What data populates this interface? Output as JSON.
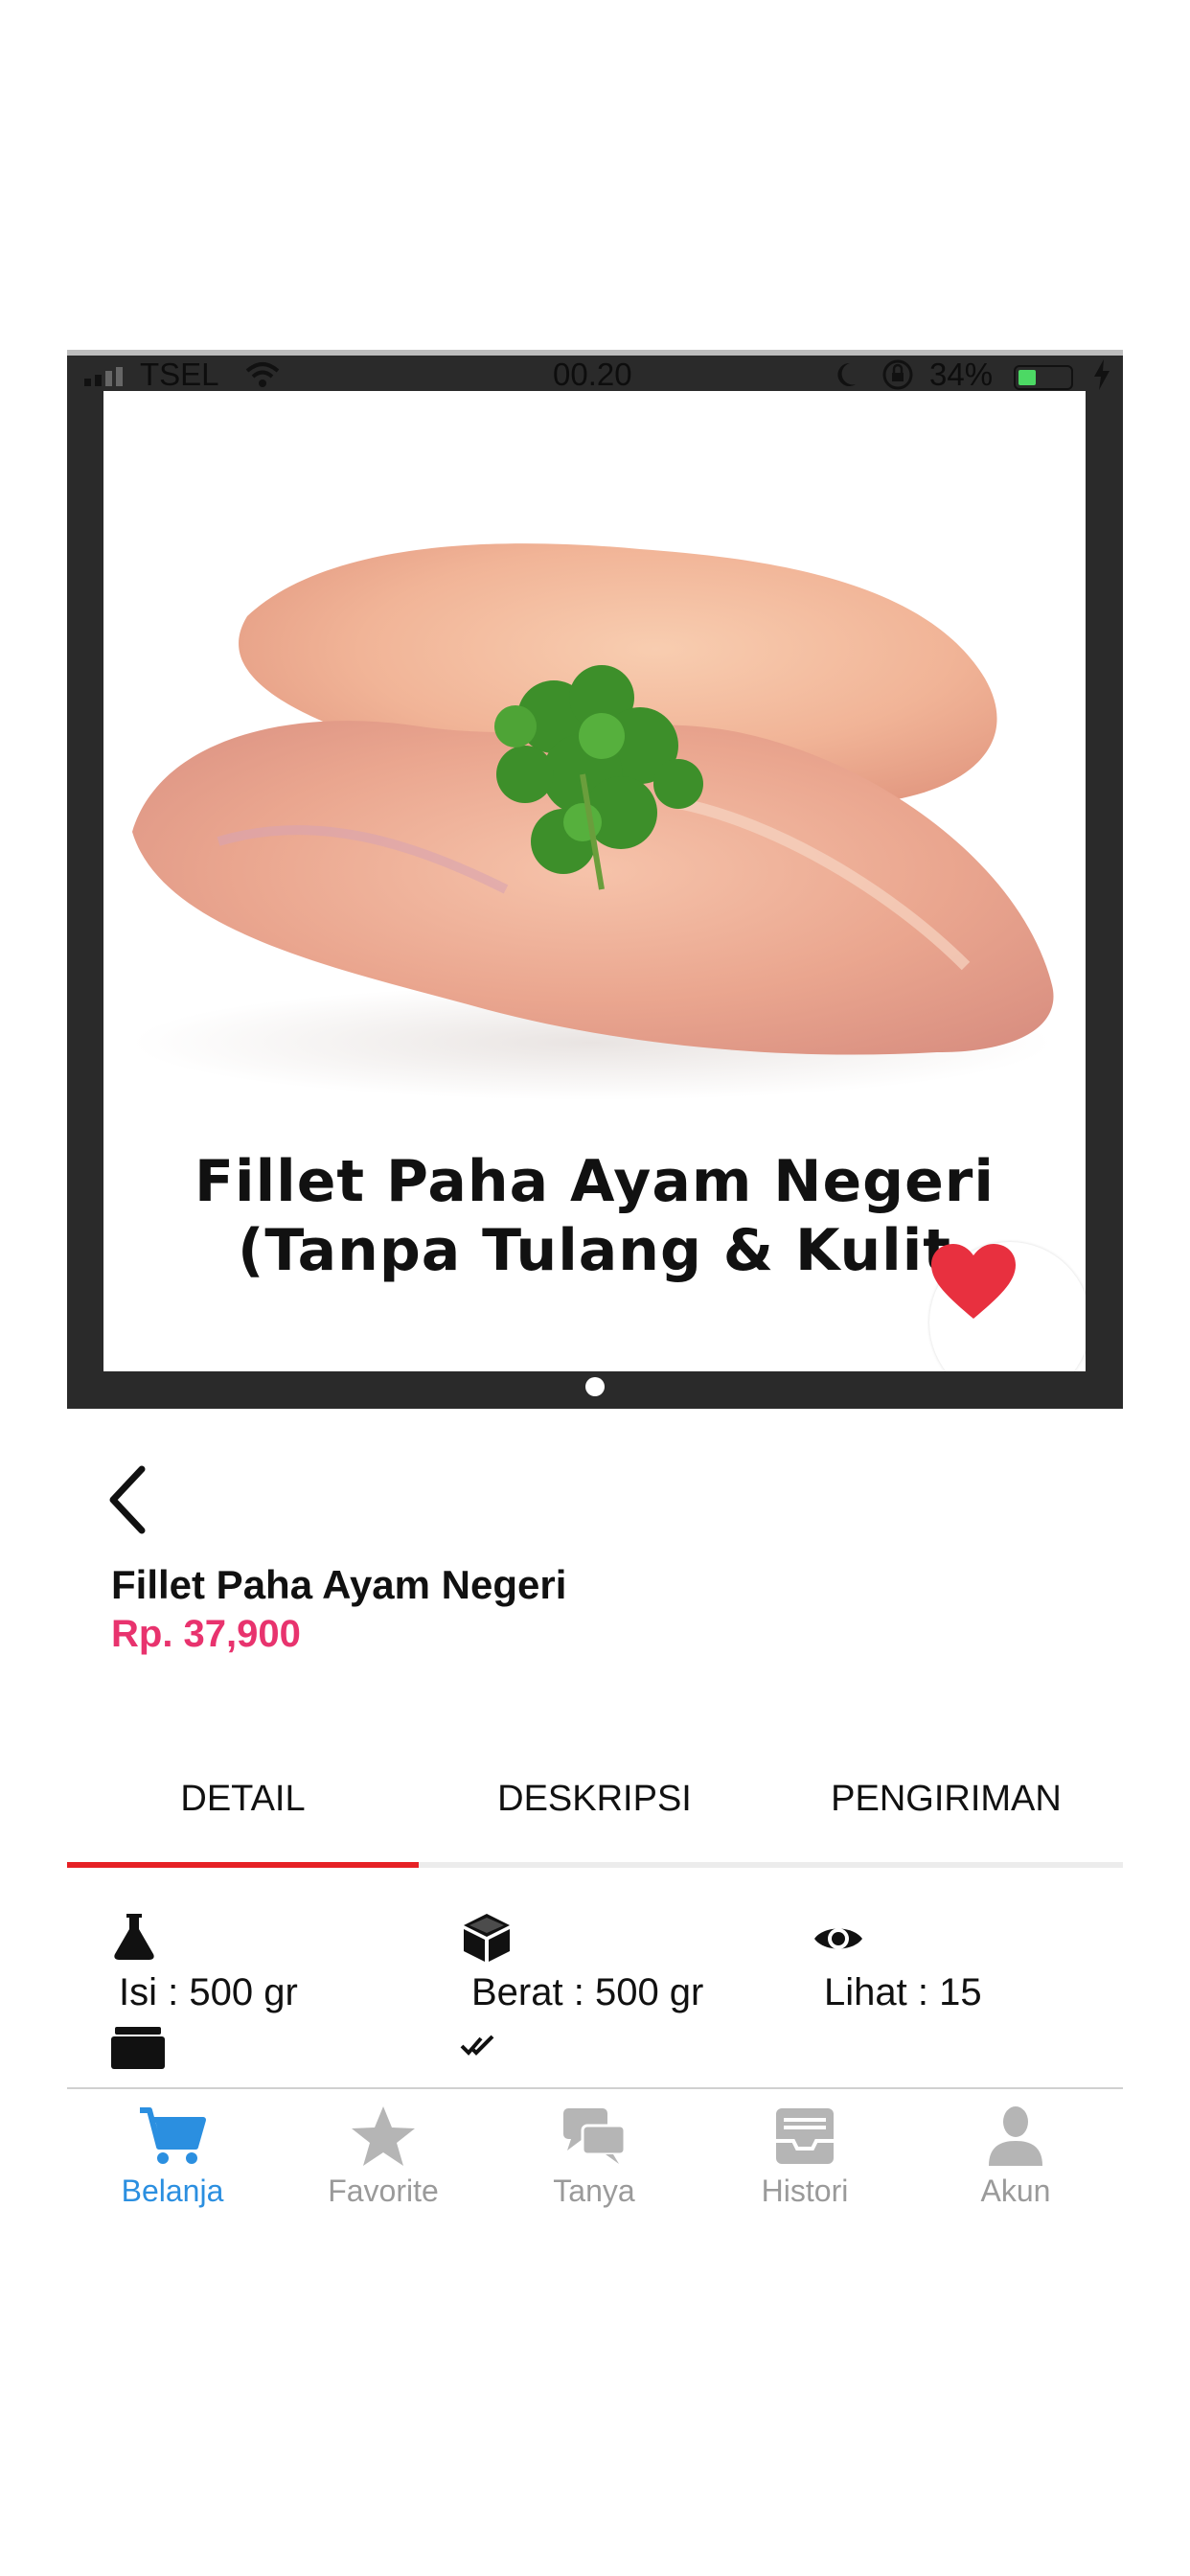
{
  "status_bar": {
    "carrier": "TSEL",
    "time": "00.20",
    "battery_percent": "34%",
    "battery_level": 0.34
  },
  "product": {
    "image_caption_line1": "Fillet Paha Ayam Negeri",
    "image_caption_line2": "(Tanpa Tulang & Kulit",
    "name": "Fillet Paha Ayam Negeri",
    "price": "Rp. 37,900",
    "favorite_icon": "heart-icon"
  },
  "carousel": {
    "current_page": 1
  },
  "tabs": {
    "items": [
      {
        "label": "DETAIL"
      },
      {
        "label": "DESKRIPSI"
      },
      {
        "label": "PENGIRIMAN"
      }
    ],
    "active_index": 0
  },
  "details": {
    "isi": "Isi : 500 gr",
    "berat": "Berat : 500 gr",
    "lihat": "Lihat : 15",
    "icons": [
      "flask-icon",
      "box-icon",
      "eye-icon",
      "package-icon",
      "double-check-icon"
    ]
  },
  "bottom_nav": {
    "items": [
      {
        "label": "Belanja",
        "icon": "cart-icon"
      },
      {
        "label": "Favorite",
        "icon": "star-icon"
      },
      {
        "label": "Tanya",
        "icon": "chat-icon"
      },
      {
        "label": "Histori",
        "icon": "inbox-icon"
      },
      {
        "label": "Akun",
        "icon": "user-icon"
      }
    ],
    "active_index": 0
  },
  "colors": {
    "price": "#e8336e",
    "tab_active": "#e62125",
    "nav_active": "#2b8fe0",
    "nav_inactive": "#9a9a9a",
    "heart": "#e8303f"
  }
}
